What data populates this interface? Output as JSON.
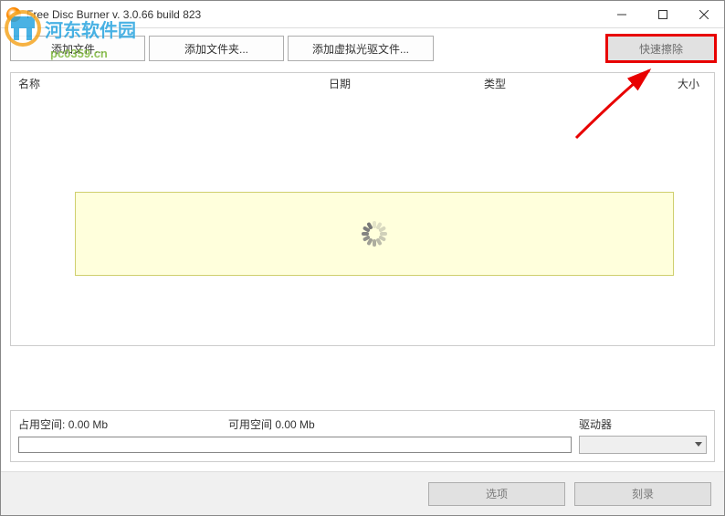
{
  "title": "Free Disc Burner   v. 3.0.66 build 823",
  "watermark": {
    "text": "河东软件园",
    "url": "pc0359.cn"
  },
  "toolbar": {
    "add_files": "添加文件...",
    "add_folder": "添加文件夹...",
    "add_virtual": "添加虚拟光驱文件...",
    "quick_erase": "快速擦除"
  },
  "columns": {
    "name": "名称",
    "date": "日期",
    "type": "类型",
    "size": "大小"
  },
  "bottom": {
    "used_label": "占用空间:",
    "used_value": "0.00 Mb",
    "free_label": "可用空间",
    "free_value": "0.00 Mb",
    "drive_label": "驱动器"
  },
  "footer": {
    "options": "选项",
    "burn": "刻录"
  }
}
